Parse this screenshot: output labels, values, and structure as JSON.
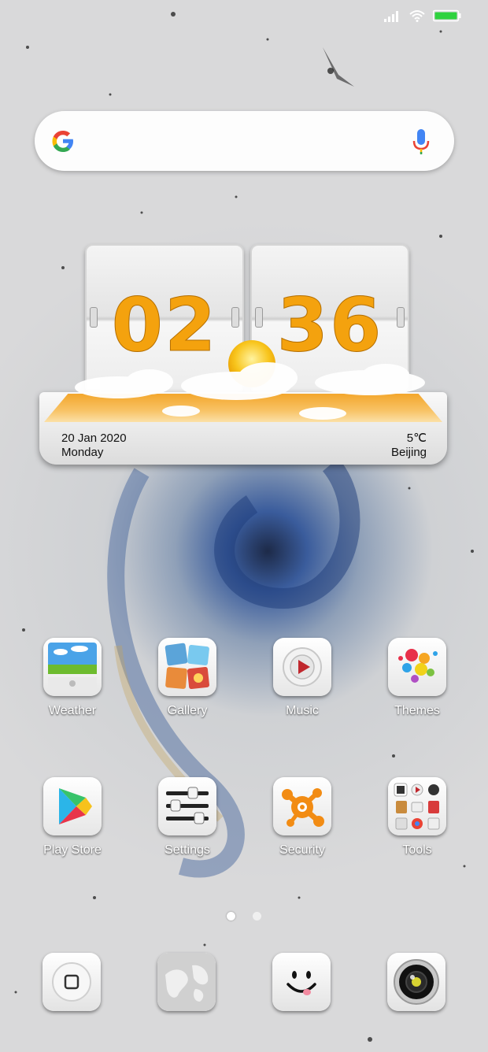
{
  "status_bar": {
    "signal_icon": "signal-bars-icon",
    "wifi_icon": "wifi-icon",
    "battery_icon": "battery-icon",
    "battery_color": "#2fd23f"
  },
  "search_bar": {
    "logo_icon": "google-g-icon",
    "mic_icon": "microphone-icon"
  },
  "clock_widget": {
    "hour": "02",
    "minute": "36",
    "date": "20 Jan 2020",
    "day": "Monday",
    "temperature": "5℃",
    "city": "Beijing",
    "weather_icon": "sun-behind-clouds-icon",
    "digit_color": "#f4a20e"
  },
  "apps_row1": [
    {
      "label": "Weather",
      "icon": "weather-landscape-icon"
    },
    {
      "label": "Gallery",
      "icon": "photo-collage-icon"
    },
    {
      "label": "Music",
      "icon": "play-disc-icon"
    },
    {
      "label": "Themes",
      "icon": "paint-splash-icon"
    }
  ],
  "apps_row2": [
    {
      "label": "Play Store",
      "icon": "play-triangle-icon"
    },
    {
      "label": "Settings",
      "icon": "sliders-icon"
    },
    {
      "label": "Security",
      "icon": "avast-icon"
    },
    {
      "label": "Tools",
      "icon": "tools-folder-icon"
    }
  ],
  "page_indicator": {
    "pages": 2,
    "active": 1
  },
  "dock": [
    {
      "icon": "home-square-icon"
    },
    {
      "icon": "globe-map-icon"
    },
    {
      "icon": "smiley-face-icon"
    },
    {
      "icon": "camera-lens-icon"
    }
  ]
}
